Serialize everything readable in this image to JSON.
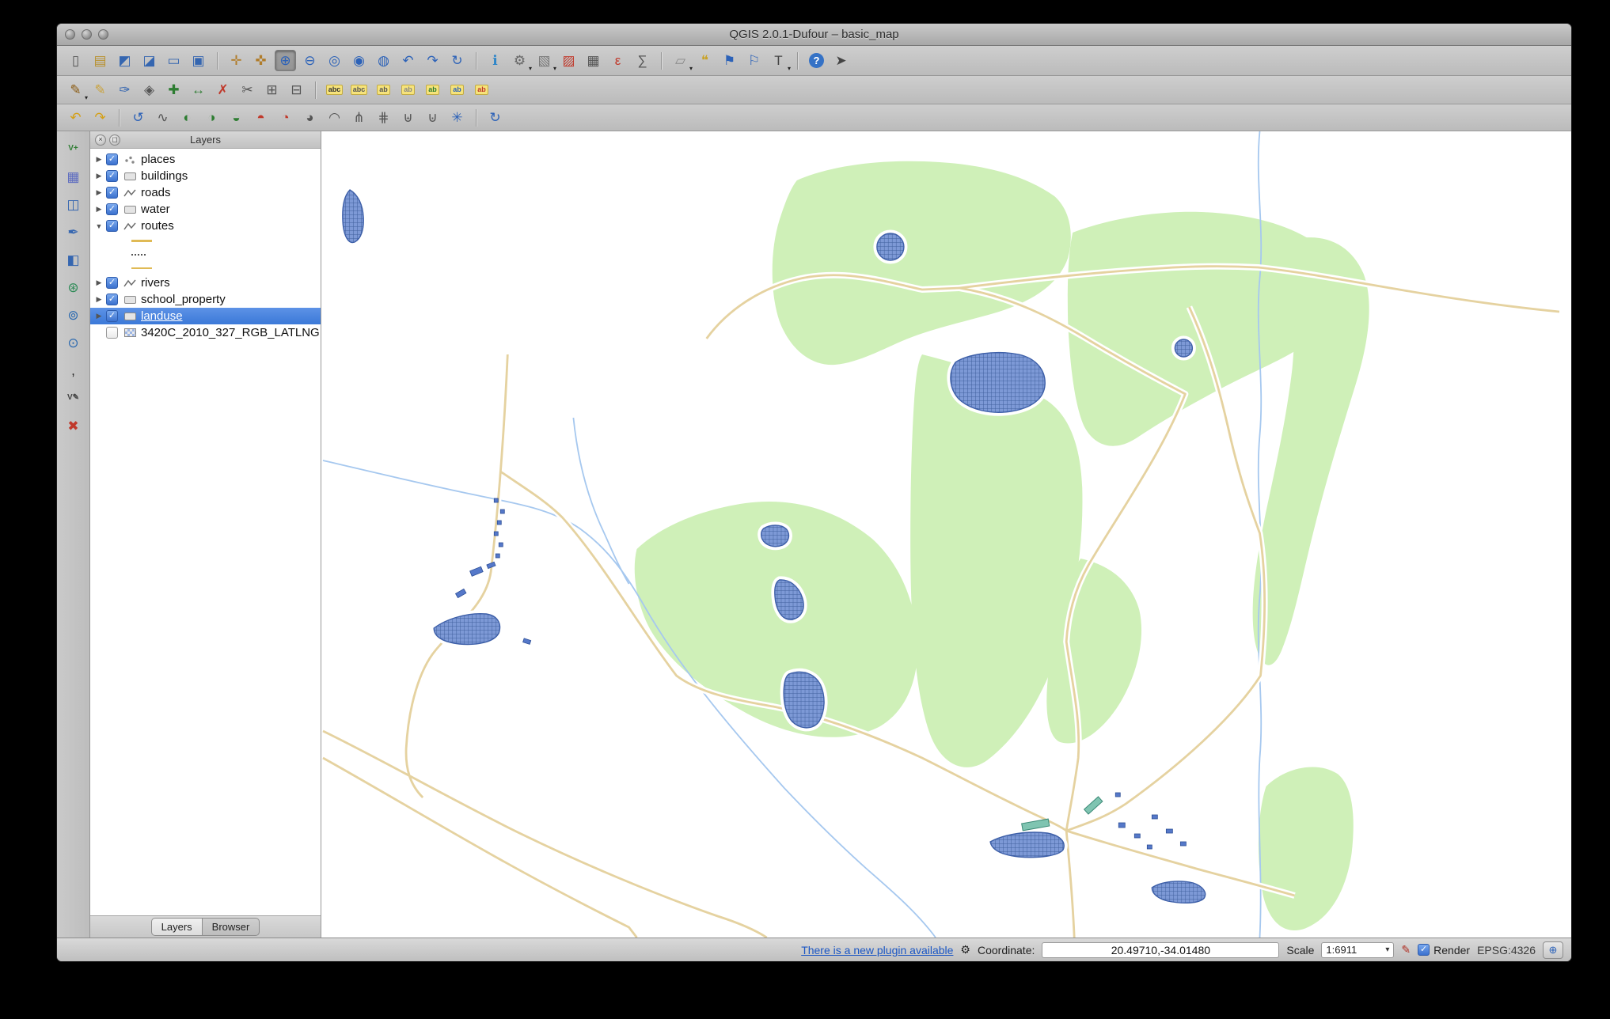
{
  "window": {
    "title": "QGIS 2.0.1-Dufour – basic_map"
  },
  "colors": {
    "selection": "#3b79d8",
    "link": "#1a56c4",
    "landuse": "#cff0b8",
    "road": "#e5d2a0",
    "river": "#a6c8ef",
    "water_fill": "#7d99d6",
    "water_line": "#3d5fa8",
    "building": "#5578c9",
    "school": "#7fc4b1"
  },
  "icons": {
    "check": "✓",
    "collapsed": "▶",
    "expanded": "▼",
    "dropdown": "▾",
    "panel_close": "×",
    "panel_float": "◻",
    "plugin": "⚙",
    "stop_render": "✎",
    "crs": "⊕"
  },
  "toolbars": {
    "row1": [
      {
        "name": "new-project",
        "glyph": "▯",
        "color": "#555"
      },
      {
        "name": "open-project",
        "glyph": "▤",
        "color": "#b8912f"
      },
      {
        "name": "save-project",
        "glyph": "◩",
        "color": "#3566b0"
      },
      {
        "name": "save-project-as",
        "glyph": "◪",
        "color": "#3566b0"
      },
      {
        "name": "new-print-composer",
        "glyph": "▭",
        "color": "#3566b0"
      },
      {
        "name": "composer-manager",
        "glyph": "▣",
        "color": "#3566b0"
      },
      {
        "sep": true
      },
      {
        "name": "pan-map",
        "glyph": "✛",
        "color": "#b07c2a"
      },
      {
        "name": "pan-to-selection",
        "glyph": "✜",
        "color": "#b07c2a"
      },
      {
        "name": "zoom-in",
        "glyph": "⊕",
        "color": "#2c62b8",
        "active": true
      },
      {
        "name": "zoom-out",
        "glyph": "⊖",
        "color": "#2c62b8"
      },
      {
        "name": "zoom-full",
        "glyph": "◎",
        "color": "#2c62b8"
      },
      {
        "name": "zoom-to-selection",
        "glyph": "◉",
        "color": "#2c62b8"
      },
      {
        "name": "zoom-to-layer",
        "glyph": "◍",
        "color": "#2c62b8"
      },
      {
        "name": "zoom-last",
        "glyph": "↶",
        "color": "#2c62b8"
      },
      {
        "name": "zoom-next",
        "glyph": "↷",
        "color": "#2c62b8"
      },
      {
        "name": "refresh-map",
        "glyph": "↻",
        "color": "#2c62b8"
      },
      {
        "sep": true
      },
      {
        "name": "identify-features",
        "glyph": "ℹ",
        "color": "#2f86c9"
      },
      {
        "name": "run-feature-action",
        "glyph": "⚙",
        "color": "#666",
        "dropdown": true
      },
      {
        "name": "select-features",
        "glyph": "▧",
        "color": "#777",
        "dropdown": true
      },
      {
        "name": "deselect-features",
        "glyph": "▨",
        "color": "#c0392b"
      },
      {
        "name": "open-attribute-table",
        "glyph": "▦",
        "color": "#555"
      },
      {
        "name": "select-by-expression",
        "glyph": "ε",
        "color": "#c0392b"
      },
      {
        "name": "open-field-calculator",
        "glyph": "∑",
        "color": "#555"
      },
      {
        "sep": true
      },
      {
        "name": "measure",
        "glyph": "▱",
        "color": "#888",
        "dropdown": true
      },
      {
        "name": "map-tips",
        "glyph": "❝",
        "color": "#c9a227"
      },
      {
        "name": "new-bookmark",
        "glyph": "⚑",
        "color": "#2c62b8"
      },
      {
        "name": "show-bookmarks",
        "glyph": "⚐",
        "color": "#2c62b8"
      },
      {
        "name": "text-annotation",
        "glyph": "T",
        "color": "#444",
        "dropdown": true
      },
      {
        "sep": true
      },
      {
        "name": "help-contents",
        "glyph": "?",
        "cls": "help"
      },
      {
        "name": "whats-this",
        "glyph": "➤",
        "color": "#444"
      }
    ],
    "row2": [
      {
        "name": "current-edits",
        "glyph": "✎",
        "color": "#8a5a10",
        "dropdown": true
      },
      {
        "name": "toggle-editing",
        "glyph": "✎",
        "color": "#caa23a"
      },
      {
        "name": "save-layer-edits",
        "glyph": "✑",
        "color": "#3566b0"
      },
      {
        "name": "node-tool",
        "glyph": "◈",
        "color": "#555"
      },
      {
        "name": "add-feature",
        "glyph": "✚",
        "color": "#2e7d32"
      },
      {
        "name": "move-feature",
        "glyph": "↔",
        "color": "#2e7d32"
      },
      {
        "name": "delete-selected",
        "glyph": "✗",
        "color": "#c0392b"
      },
      {
        "name": "cut-features",
        "glyph": "✂",
        "color": "#555"
      },
      {
        "name": "copy-features",
        "glyph": "⊞",
        "color": "#555"
      },
      {
        "name": "paste-features",
        "glyph": "⊟",
        "color": "#555"
      },
      {
        "sep": true
      },
      {
        "name": "labeling",
        "glyph": "abc",
        "color": "#333",
        "cls": "abc"
      },
      {
        "name": "change-label",
        "glyph": "abc",
        "color": "#555",
        "cls": "abc"
      },
      {
        "name": "pin-unpin-labels",
        "glyph": "ab",
        "color": "#555",
        "cls": "abc"
      },
      {
        "name": "show-hide-labels",
        "glyph": "ab",
        "color": "#888",
        "cls": "abc"
      },
      {
        "name": "move-label",
        "glyph": "ab",
        "color": "#2e7d32",
        "cls": "abc"
      },
      {
        "name": "rotate-label",
        "glyph": "ab",
        "color": "#2c62b8",
        "cls": "abc"
      },
      {
        "name": "change-label-properties",
        "glyph": "ab",
        "color": "#c0392b",
        "cls": "abc"
      }
    ],
    "row3": [
      {
        "name": "undo",
        "glyph": "↶",
        "color": "#d4a017"
      },
      {
        "name": "redo",
        "glyph": "↷",
        "color": "#d4a017"
      },
      {
        "sep": true
      },
      {
        "name": "rotate-feature",
        "glyph": "↺",
        "color": "#2c62b8"
      },
      {
        "name": "simplify-feature",
        "glyph": "∿",
        "color": "#555"
      },
      {
        "name": "add-ring",
        "glyph": "◐",
        "color": "#2e7d32"
      },
      {
        "name": "add-part",
        "glyph": "◑",
        "color": "#2e7d32"
      },
      {
        "name": "fill-ring",
        "glyph": "◒",
        "color": "#2e7d32"
      },
      {
        "name": "delete-ring",
        "glyph": "◓",
        "color": "#c0392b"
      },
      {
        "name": "delete-part",
        "glyph": "◔",
        "color": "#c0392b"
      },
      {
        "name": "reshape-features",
        "glyph": "◕",
        "color": "#555"
      },
      {
        "name": "offset-curve",
        "glyph": "◠",
        "color": "#555"
      },
      {
        "name": "split-features",
        "glyph": "⋔",
        "color": "#555"
      },
      {
        "name": "split-parts",
        "glyph": "⋕",
        "color": "#555"
      },
      {
        "name": "merge-features",
        "glyph": "⊎",
        "color": "#555"
      },
      {
        "name": "merge-attributes",
        "glyph": "⊍",
        "color": "#555"
      },
      {
        "name": "rotate-point-symbols",
        "glyph": "✳",
        "color": "#2c62b8"
      },
      {
        "sep": true
      },
      {
        "name": "circular-arrow",
        "glyph": "↻",
        "color": "#2c62b8"
      }
    ],
    "left": [
      {
        "name": "add-vector-layer",
        "glyph": "V+",
        "color": "#2e7d32"
      },
      {
        "name": "add-raster-layer",
        "glyph": "▦",
        "color": "#5c6bc0"
      },
      {
        "name": "add-postgis-layer",
        "glyph": "◫",
        "color": "#3566b0"
      },
      {
        "name": "add-spatialite-layer",
        "glyph": "✒",
        "color": "#3566b0"
      },
      {
        "name": "add-mssql-layer",
        "glyph": "◧",
        "color": "#3566b0"
      },
      {
        "name": "add-wms-layer",
        "glyph": "⊛",
        "color": "#2e8b57"
      },
      {
        "name": "add-wcs-layer",
        "glyph": "⊚",
        "color": "#2e6bb0"
      },
      {
        "name": "add-wfs-layer",
        "glyph": "⊙",
        "color": "#2e6bb0"
      },
      {
        "name": "add-delimited-text-layer",
        "glyph": ",",
        "color": "#222"
      },
      {
        "name": "new-shapefile-layer",
        "glyph": "V✎",
        "color": "#444"
      },
      {
        "name": "remove-layer",
        "glyph": "✖",
        "color": "#c0392b"
      }
    ]
  },
  "layers_panel": {
    "title": "Layers",
    "header_buttons": [
      {
        "name": "close-panel",
        "glyph": "×"
      },
      {
        "name": "float-panel",
        "glyph": "◻"
      }
    ],
    "layers": [
      {
        "label": "places",
        "type": "point",
        "checked": true
      },
      {
        "label": "buildings",
        "type": "polygon",
        "checked": true
      },
      {
        "label": "roads",
        "type": "line",
        "checked": true
      },
      {
        "label": "water",
        "type": "polygon",
        "checked": true
      },
      {
        "label": "routes",
        "type": "line",
        "checked": true,
        "expanded": true,
        "children": [
          {
            "style": "dash-tan"
          },
          {
            "style": "dot"
          },
          {
            "style": "dash-tan2"
          }
        ]
      },
      {
        "label": "rivers",
        "type": "line",
        "checked": true
      },
      {
        "label": "school_property",
        "type": "polygon",
        "checked": true
      },
      {
        "label": "landuse",
        "type": "polygon",
        "checked": true,
        "selected": true
      },
      {
        "label": "3420C_2010_327_RGB_LATLNG",
        "type": "raster",
        "checked": false,
        "expandable": false
      }
    ],
    "tabs": [
      "Layers",
      "Browser"
    ]
  },
  "status_bar": {
    "plugin_link": "There is a new plugin available",
    "coordinate_label": "Coordinate:",
    "coordinate_value": "20.49710,-34.01480",
    "scale_label": "Scale",
    "scale_value": "1:6911",
    "render_label": "Render",
    "crs": "EPSG:4326"
  }
}
